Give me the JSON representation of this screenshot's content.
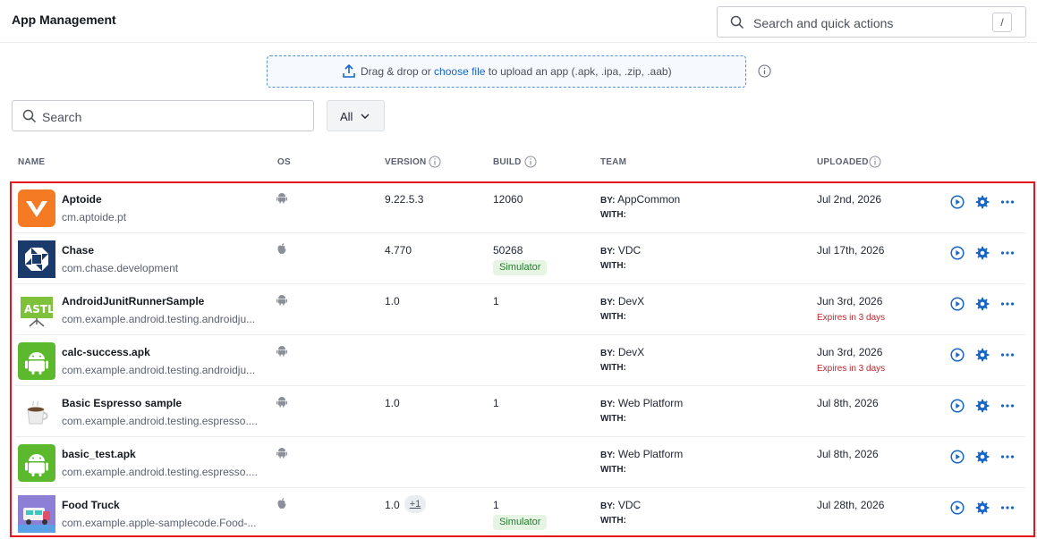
{
  "header": {
    "title": "App Management",
    "quick_search_placeholder": "Search and quick actions",
    "quick_search_shortcut": "/"
  },
  "upload": {
    "text_before": "Drag & drop or ",
    "link_text": "choose file",
    "text_after": " to upload an app (.apk, .ipa, .zip, .aab)"
  },
  "filters": {
    "search_placeholder": "Search",
    "os_filter_value": "All"
  },
  "columns": {
    "name": "NAME",
    "os": "OS",
    "version": "VERSION",
    "build": "BUILD",
    "team": "TEAM",
    "uploaded": "UPLOADED"
  },
  "team_labels": {
    "by": "BY:",
    "with": "WITH:"
  },
  "colors": {
    "accent": "#1766c6",
    "highlight": "#e8141b",
    "simulator_bg": "#e6f4e4",
    "expires": "#c0272d"
  },
  "apps": [
    {
      "icon": "aptoide-logo",
      "name": "Aptoide",
      "id": "cm.aptoide.pt",
      "os": "android",
      "version": "9.22.5.3",
      "build": "12060",
      "badge": "",
      "team": "AppCommon",
      "uploaded": "Jul 2nd, 2026",
      "expires": ""
    },
    {
      "icon": "chase-logo",
      "name": "Chase",
      "id": "com.chase.development",
      "os": "ios",
      "version": "4.770",
      "build": "50268",
      "badge": "Simulator",
      "team": "VDC",
      "uploaded": "Jul 17th, 2026",
      "expires": ""
    },
    {
      "icon": "astl-logo",
      "name": "AndroidJunitRunnerSample",
      "id": "com.example.android.testing.androidju...",
      "os": "android",
      "version": "1.0",
      "build": "1",
      "badge": "",
      "team": "DevX",
      "uploaded": "Jun 3rd, 2026",
      "expires": "Expires in 3 days"
    },
    {
      "icon": "android-logo",
      "name": "calc-success.apk",
      "id": "com.example.android.testing.androidju...",
      "os": "android",
      "version": "",
      "build": "",
      "badge": "",
      "team": "DevX",
      "uploaded": "Jun 3rd, 2026",
      "expires": "Expires in 3 days"
    },
    {
      "icon": "coffee-cup-logo",
      "name": "Basic Espresso sample",
      "id": "com.example.android.testing.espresso....",
      "os": "android",
      "version": "1.0",
      "build": "1",
      "badge": "",
      "team": "Web Platform",
      "uploaded": "Jul 8th, 2026",
      "expires": ""
    },
    {
      "icon": "android-logo",
      "name": "basic_test.apk",
      "id": "com.example.android.testing.espresso....",
      "os": "android",
      "version": "",
      "build": "",
      "badge": "",
      "team": "Web Platform",
      "uploaded": "Jul 8th, 2026",
      "expires": ""
    },
    {
      "icon": "food-truck-logo",
      "name": "Food Truck",
      "id": "com.example.apple-samplecode.Food-...",
      "os": "ios",
      "version": "1.0",
      "version_badge": "+1",
      "build": "1",
      "badge": "Simulator",
      "team": "VDC",
      "uploaded": "Jul 28th, 2026",
      "expires": ""
    }
  ]
}
